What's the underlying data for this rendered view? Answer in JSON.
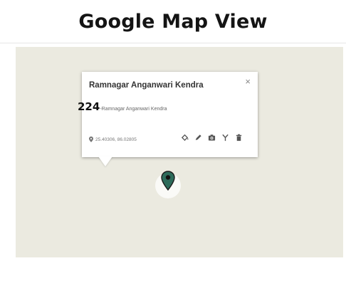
{
  "page": {
    "title": "Google Map View"
  },
  "info_window": {
    "title": "Ramnagar Anganwari Kendra",
    "id": "224",
    "subtitle": "-Ramnagar Anganwari Kendra",
    "coordinates": "25.40306, 86.02805",
    "close_label": "×",
    "actions": [
      "fill-icon",
      "edit-icon",
      "camera-icon",
      "branch-icon",
      "delete-icon"
    ]
  },
  "colors": {
    "map_background": "#ebeae0",
    "marker_fill": "#2d6b5a",
    "text_dark": "#333333"
  }
}
